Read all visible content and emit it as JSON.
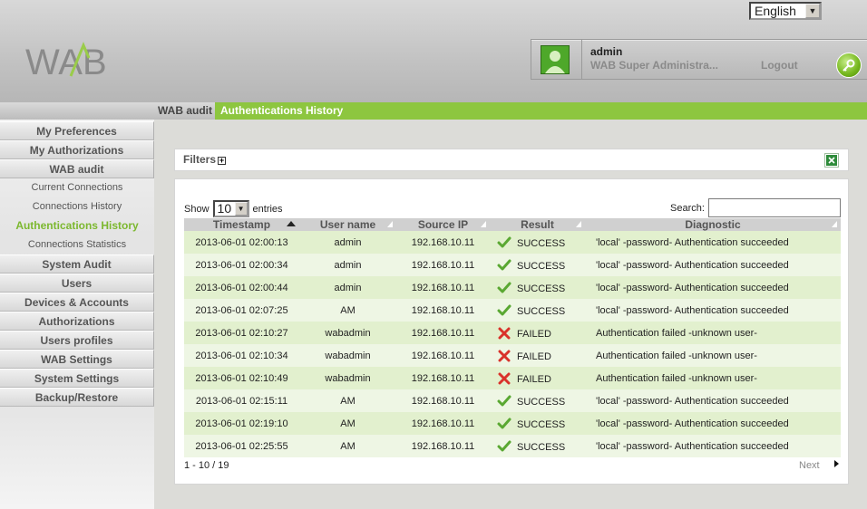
{
  "header": {
    "logo_text": "WAB",
    "language": "English",
    "user": {
      "name": "admin",
      "role": "WAB Super Administra...",
      "logout_label": "Logout"
    }
  },
  "breadcrumb": {
    "section": "WAB audit",
    "page": "Authentications History"
  },
  "sidebar": {
    "items": [
      {
        "label": "My Preferences",
        "type": "main"
      },
      {
        "label": "My Authorizations",
        "type": "main"
      },
      {
        "label": "WAB audit",
        "type": "main"
      },
      {
        "label": "Current Connections",
        "type": "sub"
      },
      {
        "label": "Connections History",
        "type": "sub"
      },
      {
        "label": "Authentications History",
        "type": "sub",
        "active": true
      },
      {
        "label": "Connections Statistics",
        "type": "sub"
      },
      {
        "label": "System Audit",
        "type": "main"
      },
      {
        "label": "Users",
        "type": "main"
      },
      {
        "label": "Devices & Accounts",
        "type": "main"
      },
      {
        "label": "Authorizations",
        "type": "main"
      },
      {
        "label": "Users profiles",
        "type": "main"
      },
      {
        "label": "WAB Settings",
        "type": "main"
      },
      {
        "label": "System Settings",
        "type": "main"
      },
      {
        "label": "Backup/Restore",
        "type": "main"
      }
    ]
  },
  "filters": {
    "label": "Filters",
    "expand_symbol": "+"
  },
  "table": {
    "show_label": "Show",
    "entries_value": "10",
    "entries_label": "entries",
    "search_label": "Search:",
    "search_value": "",
    "columns": [
      "Timestamp",
      "User name",
      "Source IP",
      "Result",
      "Diagnostic"
    ],
    "rows": [
      {
        "timestamp": "2013-06-01 02:00:13",
        "user": "admin",
        "ip": "192.168.10.11",
        "result": "SUCCESS",
        "diagnostic": "'local' -password- Authentication succeeded"
      },
      {
        "timestamp": "2013-06-01 02:00:34",
        "user": "admin",
        "ip": "192.168.10.11",
        "result": "SUCCESS",
        "diagnostic": "'local' -password- Authentication succeeded"
      },
      {
        "timestamp": "2013-06-01 02:00:44",
        "user": "admin",
        "ip": "192.168.10.11",
        "result": "SUCCESS",
        "diagnostic": "'local' -password- Authentication succeeded"
      },
      {
        "timestamp": "2013-06-01 02:07:25",
        "user": "AM",
        "ip": "192.168.10.11",
        "result": "SUCCESS",
        "diagnostic": "'local' -password- Authentication succeeded"
      },
      {
        "timestamp": "2013-06-01 02:10:27",
        "user": "wabadmin",
        "ip": "192.168.10.11",
        "result": "FAILED",
        "diagnostic": "Authentication failed -unknown user-"
      },
      {
        "timestamp": "2013-06-01 02:10:34",
        "user": "wabadmin",
        "ip": "192.168.10.11",
        "result": "FAILED",
        "diagnostic": "Authentication failed -unknown user-"
      },
      {
        "timestamp": "2013-06-01 02:10:49",
        "user": "wabadmin",
        "ip": "192.168.10.11",
        "result": "FAILED",
        "diagnostic": "Authentication failed -unknown user-"
      },
      {
        "timestamp": "2013-06-01 02:15:11",
        "user": "AM",
        "ip": "192.168.10.11",
        "result": "SUCCESS",
        "diagnostic": "'local' -password- Authentication succeeded"
      },
      {
        "timestamp": "2013-06-01 02:19:10",
        "user": "AM",
        "ip": "192.168.10.11",
        "result": "SUCCESS",
        "diagnostic": "'local' -password- Authentication succeeded"
      },
      {
        "timestamp": "2013-06-01 02:25:55",
        "user": "AM",
        "ip": "192.168.10.11",
        "result": "SUCCESS",
        "diagnostic": "'local' -password- Authentication succeeded"
      }
    ],
    "pagination_info": "1 - 10 / 19",
    "next_label": "Next"
  },
  "colors": {
    "accent_green": "#8dc63f",
    "active_nav": "#7cb82f",
    "success": "#5aa832",
    "failed": "#d9322a"
  }
}
